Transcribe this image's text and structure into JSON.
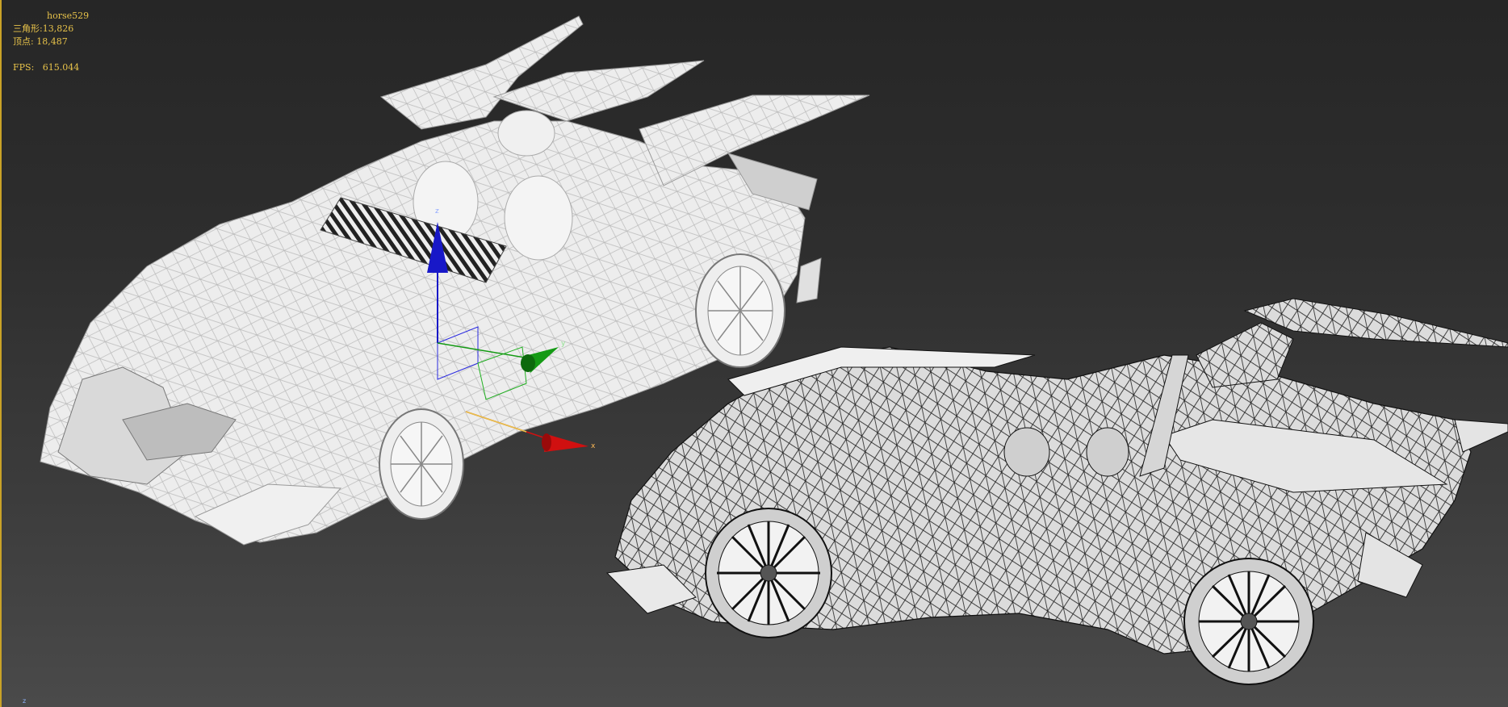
{
  "viewport": {
    "object_name": "horse529",
    "triangles_label": "三角形:",
    "triangles_value": "13,826",
    "vertices_label": "顶点:",
    "vertices_value": "18,487",
    "fps_label": "FPS:",
    "fps_value": "615.044",
    "corner_axis": "z"
  },
  "gizmo": {
    "z_label": "z",
    "y_label": "y",
    "x_label": "x",
    "x_color": "#d01010",
    "y_color": "#149a14",
    "z_color": "#1818c8"
  },
  "colors": {
    "overlay_text": "#e8c34a",
    "mesh_fill": "#e9e9e9",
    "mesh_dark": "#3a3a3a",
    "background_top": "#262626",
    "background_bottom": "#4a4a4a"
  }
}
